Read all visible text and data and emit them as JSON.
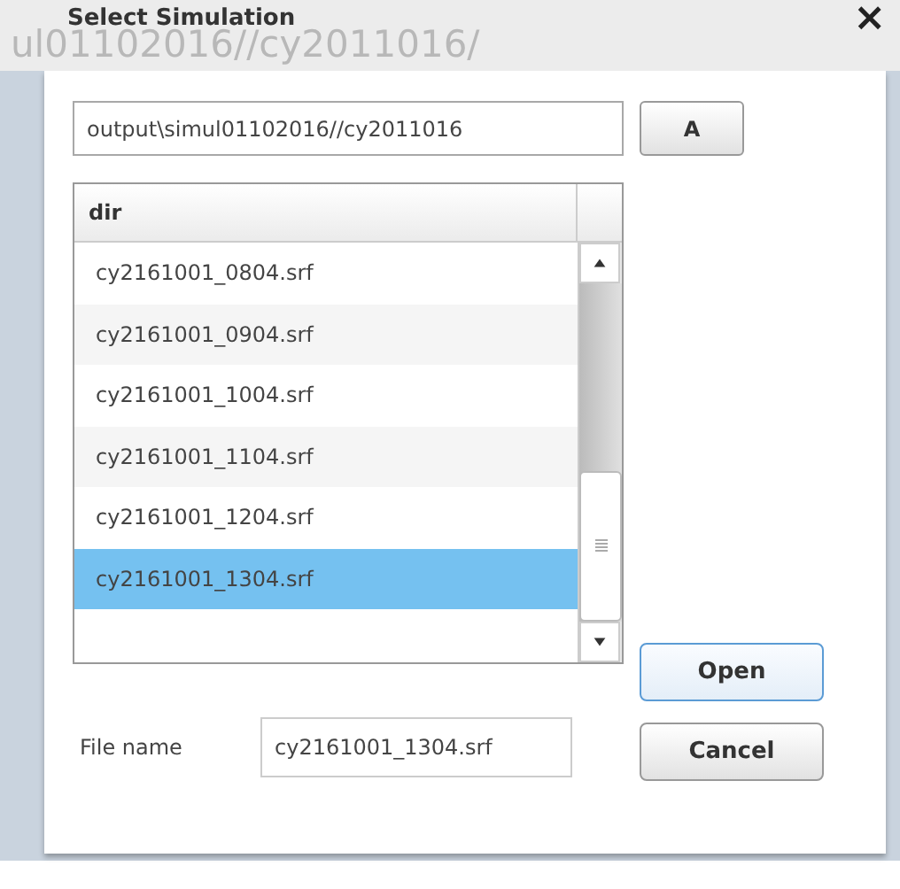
{
  "dialog": {
    "title": "Select Simulation",
    "close": "×",
    "background_path": "ul01102016//cy2011016/"
  },
  "path_field": {
    "value": "output\\simul01102016//cy2011016"
  },
  "path_button": "A",
  "file_list": {
    "column": "dir",
    "rows": [
      {
        "name": "cy2161001_0804.srf",
        "selected": false
      },
      {
        "name": "cy2161001_0904.srf",
        "selected": false
      },
      {
        "name": "cy2161001_1004.srf",
        "selected": false
      },
      {
        "name": "cy2161001_1104.srf",
        "selected": false
      },
      {
        "name": "cy2161001_1204.srf",
        "selected": false
      },
      {
        "name": "cy2161001_1304.srf",
        "selected": true
      }
    ]
  },
  "file_name": {
    "label": "File name",
    "value": "cy2161001_1304.srf"
  },
  "buttons": [
    {
      "label": "Open",
      "kind": "primary"
    },
    {
      "label": "Cancel",
      "kind": "secondary"
    }
  ]
}
